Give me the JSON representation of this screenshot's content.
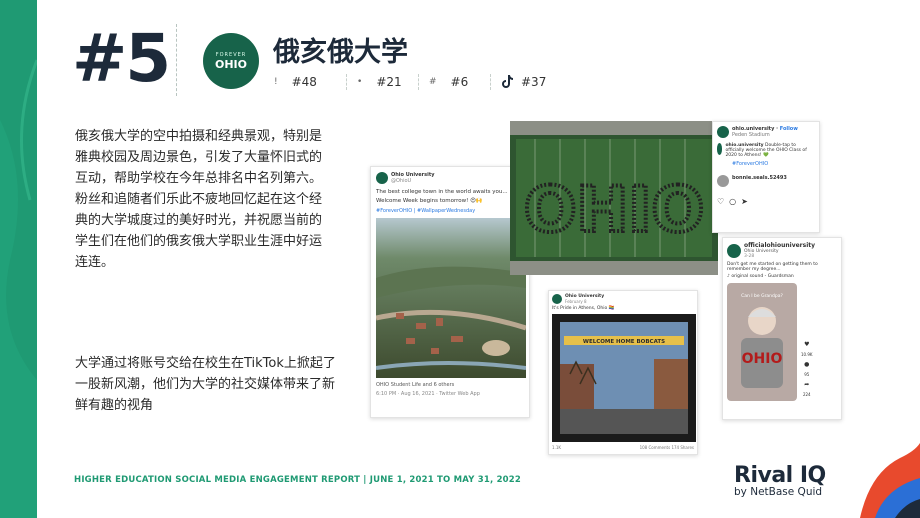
{
  "slide": {
    "rank": "#5",
    "university_name": "俄亥俄大学",
    "logo": {
      "small_text": "FOREVER",
      "big_text": "OHIO"
    },
    "platform_ranks": [
      {
        "icon": "!",
        "label": "#48"
      },
      {
        "icon": "•",
        "label": "#21"
      },
      {
        "icon": "#",
        "label": "#6"
      },
      {
        "icon": "tiktok-icon",
        "label": "#37"
      }
    ],
    "paragraph1": "俄亥俄大学的空中拍摄和经典景观，特别是雅典校园及周边景色，引发了大量怀旧式的互动，帮助学校在今年总排名中名列第六。粉丝和追随者们乐此不疲地回忆起在这个经典的大学城度过的美好时光，并祝愿当前的学生们在他们的俄亥俄大学职业生涯中好运连连。",
    "paragraph2": "大学通过将账号交给在校生在TikTok上掀起了一股新风潮，他们为大学的社交媒体带来了新鲜有趣的视角",
    "footer": "HIGHER EDUCATION SOCIAL MEDIA ENGAGEMENT REPORT | JUNE 1, 2021 TO MAY 31, 2022",
    "brand": {
      "name": "Rival IQ",
      "sub": "by NetBase Quid"
    }
  },
  "tweet": {
    "account": "Ohio University",
    "handle": "@OhioU",
    "line1": "The best college town in the world awaits you...",
    "line2": "Welcome Week begins tomorrow! 😍🙌",
    "hashtags": "#ForeverOHIO | #WallpaperWednesday",
    "tagged": "OHIO Student Life and 6 others",
    "timestamp": "6:10 PM · Aug 16, 2021 · Twitter Web App"
  },
  "instagram": {
    "account": "ohio.university",
    "follow": "Follow",
    "location": "Peden Stadium",
    "caption_user": "ohio.university",
    "caption": "Double-tap to officially welcome the OHIO Class of 2020 to Athens! 💚",
    "hashtag": "#ForeverOHIO",
    "comment_user": "bonnie.seals.52493",
    "field_text": "OHIO"
  },
  "facebook": {
    "account": "Ohio University",
    "date": "February 8",
    "caption": "It's Pride in Athens, Ohio 🏳️‍🌈",
    "banner": "WELCOME HOME BOBCATS",
    "footer_left": "1.1K",
    "footer_right": "108 Comments  174 Shares"
  },
  "tiktok": {
    "account": "officialohiouniversity",
    "sub": "Ohio University",
    "date": "3-28",
    "caption": "Don't get me started on getting them to remember my degree...",
    "sound": "original sound - Guardsman",
    "overlay": "Can I be Grandpa?",
    "likes": "10.9K",
    "comments": "95",
    "shares": "224",
    "saves": "205"
  }
}
